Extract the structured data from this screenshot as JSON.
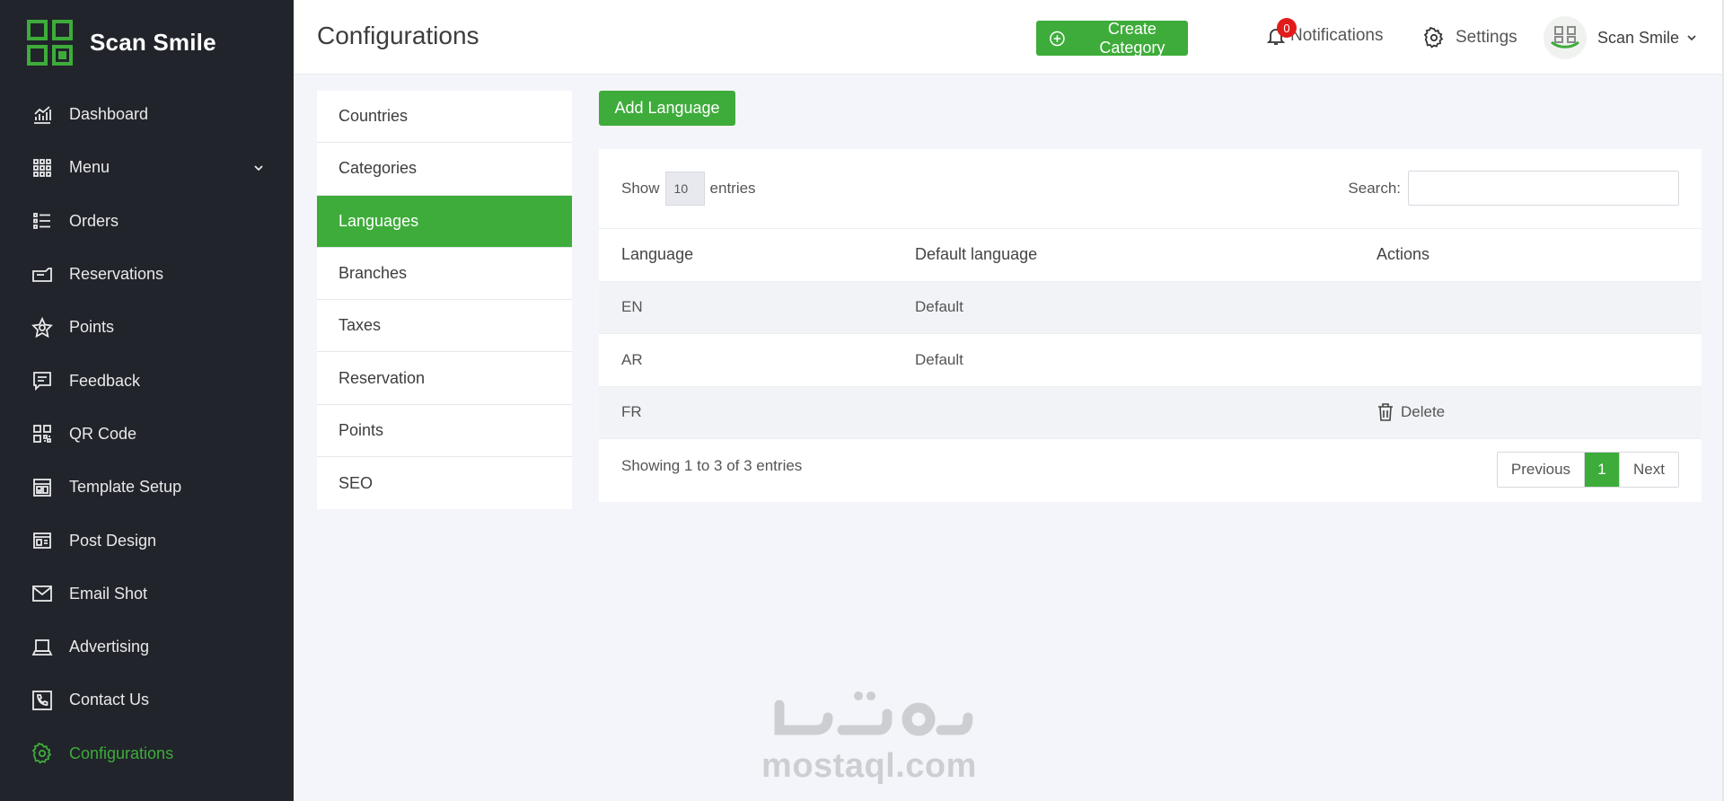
{
  "brand": {
    "name": "Scan Smile"
  },
  "sidebar": {
    "items": [
      {
        "label": "Dashboard",
        "icon": "dashboard-chart-icon",
        "active": false
      },
      {
        "label": "Menu",
        "icon": "grid-icon",
        "active": false,
        "expandable": true
      },
      {
        "label": "Orders",
        "icon": "list-icon",
        "active": false
      },
      {
        "label": "Reservations",
        "icon": "ticket-icon",
        "active": false
      },
      {
        "label": "Points",
        "icon": "star-icon",
        "active": false
      },
      {
        "label": "Feedback",
        "icon": "feedback-icon",
        "active": false
      },
      {
        "label": "QR Code",
        "icon": "qr-code-icon",
        "active": false
      },
      {
        "label": "Template Setup",
        "icon": "template-icon",
        "active": false
      },
      {
        "label": "Post Design",
        "icon": "post-design-icon",
        "active": false
      },
      {
        "label": "Email Shot",
        "icon": "mail-icon",
        "active": false
      },
      {
        "label": "Advertising",
        "icon": "laptop-icon",
        "active": false
      },
      {
        "label": "Contact Us",
        "icon": "phone-icon",
        "active": false
      },
      {
        "label": "Configurations",
        "icon": "gear-icon",
        "active": true
      }
    ]
  },
  "header": {
    "title": "Configurations",
    "create_label": "Create Category",
    "notifications_label": "Notifications",
    "notifications_count": "0",
    "settings_label": "Settings",
    "user_name": "Scan Smile"
  },
  "submenu": {
    "items": [
      {
        "label": "Countries",
        "active": false
      },
      {
        "label": "Categories",
        "active": false
      },
      {
        "label": "Languages",
        "active": true
      },
      {
        "label": "Branches",
        "active": false
      },
      {
        "label": "Taxes",
        "active": false
      },
      {
        "label": "Reservation",
        "active": false
      },
      {
        "label": "Points",
        "active": false
      },
      {
        "label": "SEO",
        "active": false
      }
    ]
  },
  "main": {
    "add_label": "Add Language",
    "show_label": "Show",
    "entries_value": "10",
    "entries_label": "entries",
    "search_label": "Search:",
    "search_value": "",
    "table": {
      "headers": [
        "Language",
        "Default language",
        "Actions"
      ],
      "rows": [
        {
          "language": "EN",
          "default": "Default",
          "action": ""
        },
        {
          "language": "AR",
          "default": "Default",
          "action": ""
        },
        {
          "language": "FR",
          "default": "",
          "action": "Delete"
        }
      ]
    },
    "info": "Showing 1 to 3 of 3 entries",
    "pagination": {
      "previous": "Previous",
      "current": "1",
      "next": "Next"
    }
  },
  "watermark": {
    "text": "mostaql.com",
    "arabic": "مستقل"
  },
  "colors": {
    "accent": "#3eac3a",
    "sidebar": "#21242b",
    "badge": "#e11b1b"
  }
}
